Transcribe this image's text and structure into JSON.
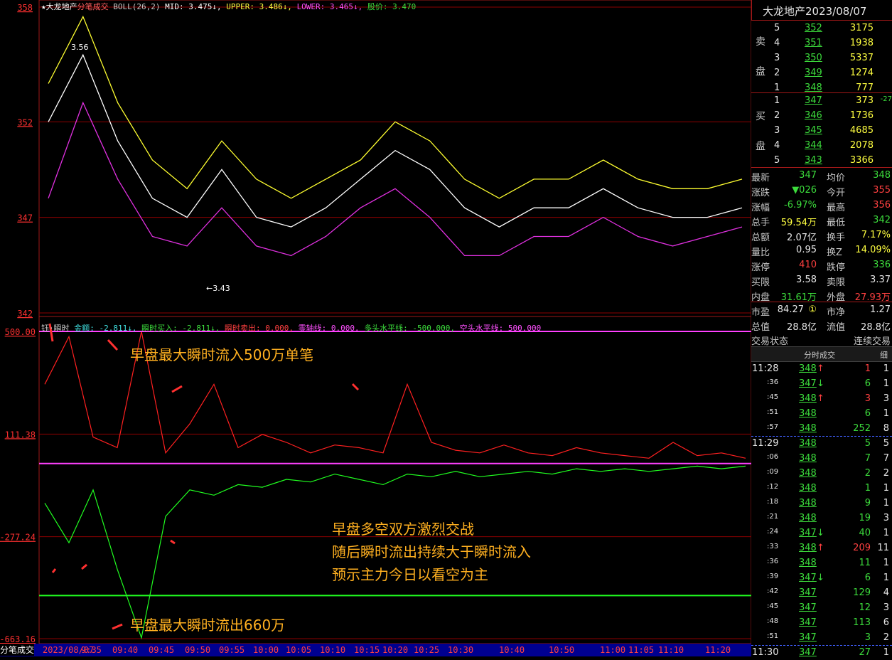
{
  "top_legend": {
    "star": "★",
    "name": "大龙地产",
    "mode": "分笔成交",
    "indicator": "BOLL(26,2)",
    "mid": "MID: 3.475↓,",
    "upper": "UPPER: 3.486↓,",
    "lower": "LOWER: 3.465↓,",
    "price": "股价: 3.470"
  },
  "bottom_legend": {
    "name": "钰·瞬时",
    "amount": "金额: -2.811↓,",
    "buy": "瞬时买入: -2.811↓,",
    "sell": "瞬时卖出: 0.000,",
    "zero": "零轴线: 0.000,",
    "long": "多头水平线: -500.000,",
    "short": "空头水平线: 500.000"
  },
  "colors": {
    "upper": "#ffff30",
    "mid": "#ffffff",
    "lower": "#e030e0",
    "inflow": "#ff2020",
    "outflow": "#20ff20",
    "grid": "#8b0000"
  },
  "chart_data": [
    {
      "type": "line",
      "title": "大龙地产 分笔成交 BOLL(26,2)",
      "y_tick_labels": [
        "358",
        "352",
        "347",
        "342"
      ],
      "ylim": [
        342,
        358
      ],
      "annotations": [
        "3.56",
        "←3.43"
      ],
      "series": [
        {
          "name": "UPPER",
          "values": [
            354,
            357.5,
            353,
            350,
            348.5,
            351,
            349,
            348,
            349,
            350,
            352,
            351,
            349,
            348,
            349,
            349,
            350,
            349,
            348.5,
            348.5,
            349
          ]
        },
        {
          "name": "MID",
          "values": [
            352,
            355.5,
            351,
            348,
            347,
            349.5,
            347,
            346.5,
            347.5,
            349,
            350.5,
            349.5,
            347.5,
            346.5,
            347.5,
            347.5,
            348.5,
            347.5,
            347,
            347,
            347.5
          ]
        },
        {
          "name": "LOWER",
          "values": [
            348,
            353,
            349,
            346,
            345.5,
            347.5,
            345.5,
            345,
            346,
            347.5,
            348.5,
            347,
            345,
            345,
            346,
            346,
            347,
            346,
            345.5,
            346,
            346.5
          ]
        }
      ]
    },
    {
      "type": "line",
      "title": "钰·瞬时",
      "y_tick_labels": [
        "500.00",
        "111.38",
        "-277.24",
        "-663.16"
      ],
      "ylim": [
        -663.16,
        500
      ],
      "series": [
        {
          "name": "瞬时买入",
          "values": [
            300,
            480,
            100,
            60,
            500,
            40,
            150,
            300,
            60,
            110,
            80,
            40,
            70,
            60,
            40,
            300,
            80,
            50,
            40,
            70,
            40,
            30,
            60,
            40,
            30,
            20,
            80,
            30,
            40,
            20
          ]
        },
        {
          "name": "瞬时卖出",
          "values": [
            -150,
            -300,
            -100,
            -400,
            -660,
            -200,
            -100,
            -120,
            -80,
            -90,
            -60,
            -70,
            -40,
            -60,
            -80,
            -40,
            -50,
            -30,
            -50,
            -40,
            -30,
            -40,
            -20,
            -30,
            -20,
            -30,
            -20,
            -10,
            -20,
            -10
          ]
        },
        {
          "name": "零轴线",
          "values": [
            0
          ]
        },
        {
          "name": "多头水平线",
          "values": [
            -500
          ]
        },
        {
          "name": "空头水平线",
          "values": [
            500
          ]
        }
      ]
    }
  ],
  "x_axis_labels": [
    "2023/08/07",
    "9:35",
    "09:40",
    "09:45",
    "09:50",
    "09:55",
    "10:00",
    "10:05",
    "10:10",
    "10:15",
    "10:20",
    "10:25",
    "10:30",
    "10:40",
    "10:50",
    "11:00",
    "11:05",
    "11:10",
    "11:20"
  ],
  "bottom_left_label": "分笔成交",
  "annotations": {
    "max_in": "早盘最大瞬时流入500万单笔",
    "max_out": "早盘最大瞬时流出660万",
    "summary_1": "早盘多空双方激烈交战",
    "summary_2": "随后瞬时流出持续大于瞬时流入",
    "summary_3": "预示主力今日以看空为主"
  },
  "right": {
    "header": "大龙地产2023/08/07",
    "sell_label_1": "卖",
    "sell_label_2": "盘",
    "buy_label_1": "买",
    "buy_label_2": "盘",
    "sells": [
      {
        "lvl": "5",
        "price": "352",
        "vol": "3175"
      },
      {
        "lvl": "4",
        "price": "351",
        "vol": "1938"
      },
      {
        "lvl": "3",
        "price": "350",
        "vol": "5337"
      },
      {
        "lvl": "2",
        "price": "349",
        "vol": "1274"
      },
      {
        "lvl": "1",
        "price": "348",
        "vol": "777"
      }
    ],
    "buys": [
      {
        "lvl": "1",
        "price": "347",
        "vol": "373",
        "extra": "-27"
      },
      {
        "lvl": "2",
        "price": "346",
        "vol": "1736",
        "extra": ""
      },
      {
        "lvl": "3",
        "price": "345",
        "vol": "4685",
        "extra": ""
      },
      {
        "lvl": "4",
        "price": "344",
        "vol": "2078",
        "extra": ""
      },
      {
        "lvl": "5",
        "price": "343",
        "vol": "3366",
        "extra": ""
      }
    ],
    "stats": [
      {
        "l1": "最新",
        "v1": "347",
        "c1": "green",
        "l2": "均价",
        "v2": "348",
        "c2": "green"
      },
      {
        "l1": "涨跌",
        "v1": "▼026",
        "c1": "green",
        "l2": "今开",
        "v2": "355",
        "c2": "red"
      },
      {
        "l1": "涨幅",
        "v1": "-6.97%",
        "c1": "green",
        "l2": "最高",
        "v2": "356",
        "c2": "red"
      },
      {
        "l1": "总手",
        "v1": "59.54万",
        "c1": "yellow",
        "l2": "最低",
        "v2": "342",
        "c2": "green"
      },
      {
        "l1": "总额",
        "v1": "2.07亿",
        "c1": "white",
        "l2": "换手",
        "v2": "7.17%",
        "c2": "yellow"
      },
      {
        "l1": "量比",
        "v1": "0.95",
        "c1": "white",
        "l2": "换Z",
        "v2": "14.09%",
        "c2": "yellow"
      },
      {
        "l1": "涨停",
        "v1": "410",
        "c1": "red",
        "l2": "跌停",
        "v2": "336",
        "c2": "green"
      },
      {
        "l1": "买限",
        "v1": "3.58",
        "c1": "white",
        "l2": "卖限",
        "v2": "3.37",
        "c2": "white"
      },
      {
        "l1": "内盘",
        "v1": "31.61万",
        "c1": "green",
        "l2": "外盘",
        "v2": "27.93万",
        "c2": "red"
      }
    ],
    "stats2": [
      {
        "l1": "市盈",
        "v1": "84.27",
        "c1": "white",
        "l2": "市净",
        "v2": "1.27",
        "c2": "white"
      },
      {
        "l1": "总值",
        "v1": "28.8亿",
        "c1": "white",
        "l2": "流值",
        "v2": "28.8亿",
        "c2": "white"
      }
    ],
    "pe_mark": "①",
    "trade_state_label": "交易状态",
    "trade_state_value": "连续交易",
    "ticks_header": "分时成交",
    "ticks_detail": "细",
    "ticks": [
      {
        "t": "11:28",
        "p": "348",
        "d": "↑",
        "pc": "red",
        "v": "1",
        "n": "1"
      },
      {
        "t": ":36",
        "p": "347",
        "d": "↓",
        "pc": "green",
        "v": "6",
        "n": "1"
      },
      {
        "t": ":45",
        "p": "348",
        "d": "↑",
        "pc": "red",
        "v": "3",
        "n": "3"
      },
      {
        "t": ":51",
        "p": "348",
        "d": "",
        "pc": "green",
        "v": "6",
        "n": "1"
      },
      {
        "t": ":57",
        "p": "348",
        "d": "",
        "pc": "green",
        "v": "252",
        "n": "8"
      },
      {
        "t": "11:29",
        "p": "348",
        "d": "",
        "pc": "green",
        "v": "5",
        "n": "5"
      },
      {
        "t": ":06",
        "p": "348",
        "d": "",
        "pc": "green",
        "v": "7",
        "n": "7"
      },
      {
        "t": ":09",
        "p": "348",
        "d": "",
        "pc": "green",
        "v": "2",
        "n": "2"
      },
      {
        "t": ":12",
        "p": "348",
        "d": "",
        "pc": "green",
        "v": "1",
        "n": "1"
      },
      {
        "t": ":18",
        "p": "348",
        "d": "",
        "pc": "green",
        "v": "9",
        "n": "1"
      },
      {
        "t": ":21",
        "p": "348",
        "d": "",
        "pc": "green",
        "v": "19",
        "n": "3"
      },
      {
        "t": ":24",
        "p": "347",
        "d": "↓",
        "pc": "green",
        "v": "40",
        "n": "1"
      },
      {
        "t": ":33",
        "p": "348",
        "d": "↑",
        "pc": "red",
        "v": "209",
        "n": "11"
      },
      {
        "t": ":36",
        "p": "348",
        "d": "",
        "pc": "green",
        "v": "11",
        "n": "1"
      },
      {
        "t": ":39",
        "p": "347",
        "d": "↓",
        "pc": "green",
        "v": "6",
        "n": "1"
      },
      {
        "t": ":42",
        "p": "347",
        "d": "",
        "pc": "green",
        "v": "129",
        "n": "4"
      },
      {
        "t": ":45",
        "p": "347",
        "d": "",
        "pc": "green",
        "v": "12",
        "n": "3"
      },
      {
        "t": ":48",
        "p": "347",
        "d": "",
        "pc": "green",
        "v": "113",
        "n": "6"
      },
      {
        "t": ":51",
        "p": "347",
        "d": "",
        "pc": "green",
        "v": "3",
        "n": "2"
      },
      {
        "t": "11:30",
        "p": "347",
        "d": "",
        "pc": "green",
        "v": "27",
        "n": "1"
      }
    ]
  }
}
